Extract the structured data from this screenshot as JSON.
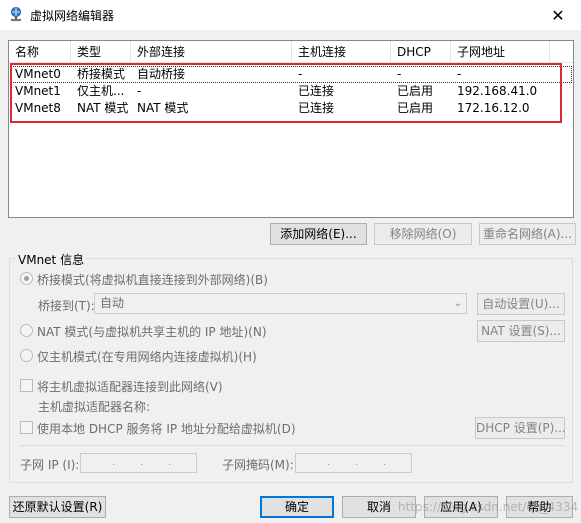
{
  "window": {
    "title": "虚拟网络编辑器",
    "close_glyph": "✕"
  },
  "list": {
    "columns": [
      "名称",
      "类型",
      "外部连接",
      "主机连接",
      "DHCP",
      "子网地址"
    ],
    "rows": [
      {
        "name": "VMnet0",
        "type": "桥接模式",
        "external": "自动桥接",
        "host": "-",
        "dhcp": "-",
        "subnet": "-"
      },
      {
        "name": "VMnet1",
        "type": "仅主机...",
        "external": "-",
        "host": "已连接",
        "dhcp": "已启用",
        "subnet": "192.168.41.0"
      },
      {
        "name": "VMnet8",
        "type": "NAT 模式",
        "external": "NAT 模式",
        "host": "已连接",
        "dhcp": "已启用",
        "subnet": "172.16.12.0"
      }
    ]
  },
  "list_buttons": {
    "add": "添加网络(E)...",
    "remove": "移除网络(O)",
    "rename": "重命名网络(A)..."
  },
  "vmnet_info": {
    "legend": "VMnet 信息",
    "bridge_radio": "桥接模式(将虚拟机直接连接到外部网络)(B)",
    "bridge_to_label": "桥接到(T):",
    "bridge_to_value": "自动",
    "auto_settings": "自动设置(U)...",
    "nat_radio": "NAT 模式(与虚拟机共享主机的 IP 地址)(N)",
    "nat_settings": "NAT 设置(S)...",
    "hostonly_radio": "仅主机模式(在专用网络内连接虚拟机)(H)",
    "connect_adapter": "将主机虚拟适配器连接到此网络(V)",
    "adapter_name_label": "主机虚拟适配器名称:",
    "use_dhcp": "使用本地 DHCP 服务将 IP 地址分配给虚拟机(D)",
    "dhcp_settings": "DHCP 设置(P)...",
    "subnet_ip_label": "子网 IP (I):",
    "subnet_mask_label": "子网掩码(M):",
    "ip_dot": "."
  },
  "footer": {
    "restore": "还原默认设置(R)",
    "ok": "确定",
    "cancel": "取消",
    "apply": "应用(A)",
    "help": "帮助"
  },
  "watermark": "https://blog.csdn.net/qq_4334"
}
